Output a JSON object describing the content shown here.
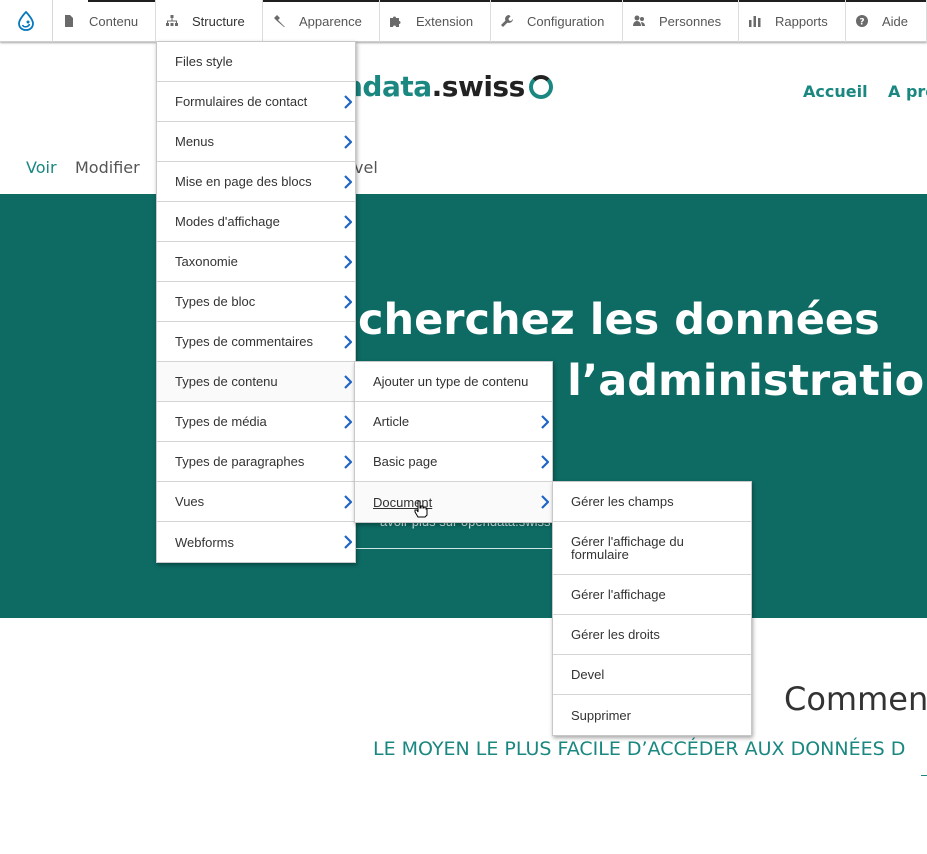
{
  "toolbar": {
    "logo_icon": "drupal-drop-icon",
    "items": [
      {
        "label": "Contenu",
        "icon": "file-icon"
      },
      {
        "label": "Structure",
        "icon": "sitemap-icon"
      },
      {
        "label": "Apparence",
        "icon": "wrench-icon"
      },
      {
        "label": "Extension",
        "icon": "puzzle-icon"
      },
      {
        "label": "Configuration",
        "icon": "wrench-icon"
      },
      {
        "label": "Personnes",
        "icon": "people-icon"
      },
      {
        "label": "Rapports",
        "icon": "chart-icon"
      },
      {
        "label": "Aide",
        "icon": "question-icon"
      }
    ],
    "active": "Structure"
  },
  "site": {
    "logo_part1": "ndata",
    "logo_part2": ".swiss",
    "nav": [
      "Accueil",
      "A pro"
    ]
  },
  "local_tabs": {
    "view": "Voir",
    "edit": "Modifier",
    "devel_fragment": "vel"
  },
  "hero": {
    "title_line1": "cherchez les données",
    "title_line2": "e l’administration",
    "link_fragment": "avoir plus sur opendata.swiss"
  },
  "section": {
    "title": "Comment",
    "subtitle": "LE MOYEN LE PLUS FACILE D’ACCÉDER AUX DONNÉES D"
  },
  "structure_menu": {
    "items": [
      {
        "label": "Files style",
        "has_submenu": false
      },
      {
        "label": "Formulaires de contact",
        "has_submenu": true
      },
      {
        "label": "Menus",
        "has_submenu": true
      },
      {
        "label": "Mise en page des blocs",
        "has_submenu": true
      },
      {
        "label": "Modes d'affichage",
        "has_submenu": true
      },
      {
        "label": "Taxonomie",
        "has_submenu": true
      },
      {
        "label": "Types de bloc",
        "has_submenu": true
      },
      {
        "label": "Types de commentaires",
        "has_submenu": true
      },
      {
        "label": "Types de contenu",
        "has_submenu": true
      },
      {
        "label": "Types de média",
        "has_submenu": true
      },
      {
        "label": "Types de paragraphes",
        "has_submenu": true
      },
      {
        "label": "Vues",
        "has_submenu": true
      },
      {
        "label": "Webforms",
        "has_submenu": true
      }
    ]
  },
  "content_types_menu": {
    "items": [
      {
        "label": "Ajouter un type de contenu",
        "has_submenu": false
      },
      {
        "label": "Article",
        "has_submenu": true
      },
      {
        "label": "Basic page",
        "has_submenu": true
      },
      {
        "label": "Document",
        "has_submenu": true
      }
    ]
  },
  "document_menu": {
    "items": [
      {
        "label": "Gérer les champs"
      },
      {
        "label": "Gérer l'affichage du formulaire"
      },
      {
        "label": "Gérer l'affichage"
      },
      {
        "label": "Gérer les droits"
      },
      {
        "label": "Devel"
      },
      {
        "label": "Supprimer"
      }
    ]
  },
  "colors": {
    "brand_teal": "#1a8780",
    "hero_bg": "#0d6b64",
    "chevron_blue": "#1f64c8",
    "drupal_blue": "#0678be"
  }
}
